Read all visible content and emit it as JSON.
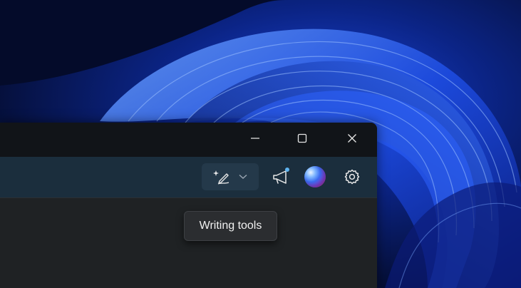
{
  "window": {
    "minimize_icon": "minimize-icon",
    "maximize_icon": "maximize-icon",
    "close_icon": "close-icon"
  },
  "toolbar": {
    "writing_tools_icon": "pen-sparkle-icon",
    "writing_tools_dropdown_icon": "chevron-down-icon",
    "whats_new_icon": "megaphone-icon",
    "profile_icon": "avatar",
    "settings_icon": "gear-icon"
  },
  "tooltip": {
    "text": "Writing tools"
  },
  "colors": {
    "wallpaper": "#0a1f8f",
    "title_bar": "#111418",
    "toolbar": "#1b2e3d",
    "content": "#1f2224",
    "notification_dot": "#5fb4f0"
  }
}
